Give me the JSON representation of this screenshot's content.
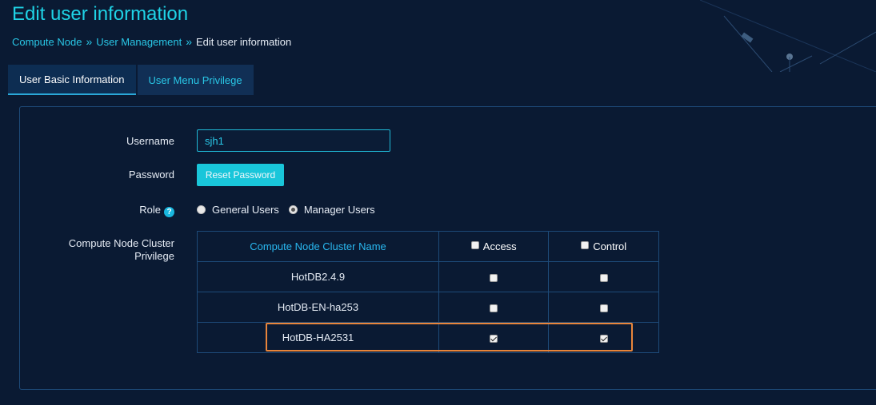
{
  "page": {
    "title": "Edit user information",
    "breadcrumb": {
      "items": [
        "Compute Node",
        "User Management"
      ],
      "separator": "»",
      "current": "Edit user information"
    }
  },
  "tabs": [
    {
      "label": "User Basic Information",
      "active": true
    },
    {
      "label": "User Menu Privilege",
      "active": false
    }
  ],
  "form": {
    "username": {
      "label": "Username",
      "value": "sjh1"
    },
    "password": {
      "label": "Password",
      "button": "Reset Password"
    },
    "role": {
      "label": "Role",
      "help_icon": "?",
      "options": [
        {
          "label": "General Users",
          "checked": false
        },
        {
          "label": "Manager Users",
          "checked": true
        }
      ]
    },
    "cluster_privilege": {
      "label_line1": "Compute Node Cluster",
      "label_line2": "Privilege",
      "headers": {
        "name": "Compute Node Cluster Name",
        "access": "Access",
        "control": "Control"
      },
      "rows": [
        {
          "name": "HotDB2.4.9",
          "access": false,
          "control": false
        },
        {
          "name": "HotDB-EN-ha253",
          "access": false,
          "control": false
        },
        {
          "name": "HotDB-HA2531",
          "access": true,
          "control": true
        }
      ]
    }
  },
  "colors": {
    "background": "#0a1a33",
    "accent": "#1fd3e6",
    "highlight": "#e9853b"
  }
}
